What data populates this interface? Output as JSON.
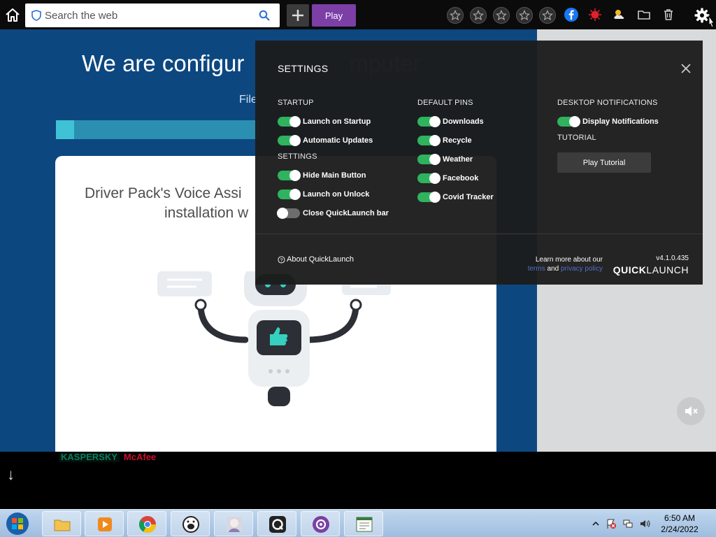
{
  "topbar": {
    "search_placeholder": "Search the web",
    "play_label": "Play"
  },
  "installer": {
    "title_visible": "We are configur",
    "title_tail": "mputer",
    "subtitle": "File",
    "progress": 0.09,
    "card_title_line1": "Driver Pack's Voice Assi",
    "card_title_line2": "installation w"
  },
  "strip": {
    "brand_left": "KASPERSKY",
    "brand_right": "McAfee"
  },
  "settings": {
    "title": "SETTINGS",
    "startup": {
      "title": "STARTUP",
      "items": [
        {
          "label": "Launch on Startup",
          "on": true
        },
        {
          "label": "Automatic Updates",
          "on": true
        }
      ]
    },
    "settings_section": {
      "title": "SETTINGS",
      "items": [
        {
          "label": "Hide Main Button",
          "on": true
        },
        {
          "label": "Launch on Unlock",
          "on": true
        },
        {
          "label": "Close QuickLaunch bar",
          "on": false
        }
      ]
    },
    "default_pins": {
      "title": "DEFAULT PINS",
      "items": [
        {
          "label": "Downloads",
          "on": true
        },
        {
          "label": "Recycle",
          "on": true
        },
        {
          "label": "Weather",
          "on": true
        },
        {
          "label": "Facebook",
          "on": true
        },
        {
          "label": "Covid Tracker",
          "on": true
        }
      ]
    },
    "notifications": {
      "title": "DESKTOP NOTIFICATIONS",
      "items": [
        {
          "label": "Display Notifications",
          "on": true
        }
      ]
    },
    "tutorial": {
      "title": "TUTORIAL",
      "button": "Play Tutorial"
    },
    "footer": {
      "about": "About QuickLaunch",
      "learn_prefix": "Learn more about our",
      "terms": "terms",
      "and": "and",
      "privacy": "privacy policy",
      "version": "v4.1.0.435",
      "brand_bold": "QUICK",
      "brand_light": "LAUNCH"
    }
  },
  "taskbar": {
    "time": "6:50 AM",
    "date": "2/24/2022"
  },
  "colors": {
    "toggle_on": "#2fb35e",
    "play_purple": "#7b3fa6",
    "installer_blue": "#0d4780",
    "link_blue": "#4f70c9"
  }
}
